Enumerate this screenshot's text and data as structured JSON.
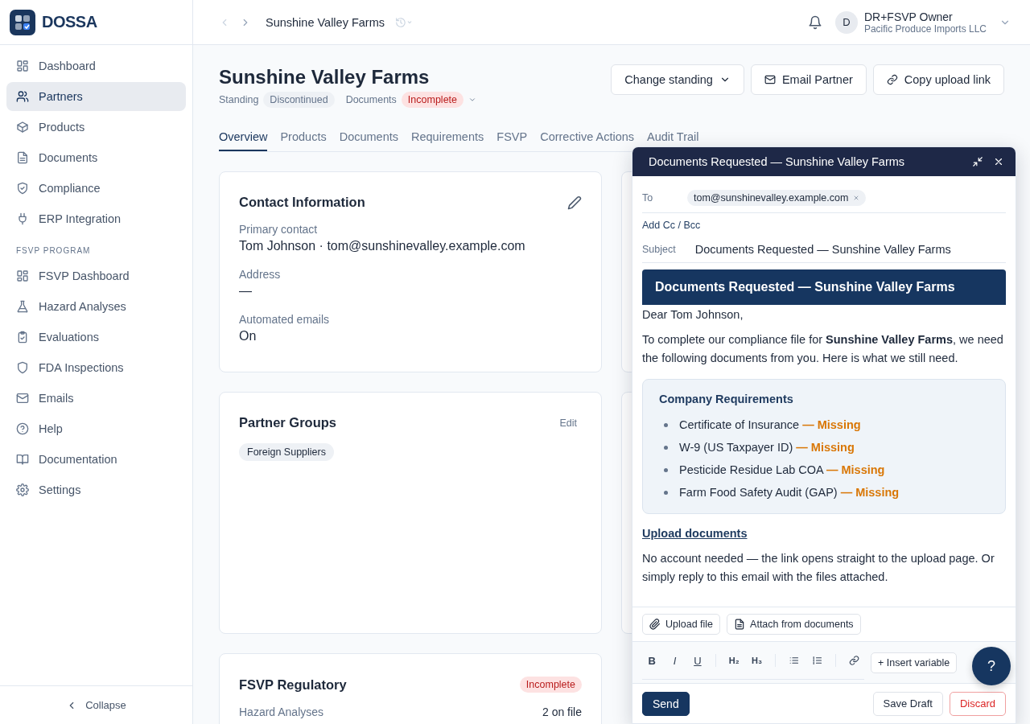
{
  "brand": {
    "name": "DOSSA"
  },
  "sidebar": {
    "groups": [
      {
        "items": [
          {
            "label": "Dashboard",
            "selected": false
          },
          {
            "label": "Partners",
            "selected": true
          },
          {
            "label": "Products",
            "selected": false
          },
          {
            "label": "Documents",
            "selected": false
          },
          {
            "label": "Compliance",
            "selected": false
          },
          {
            "label": "ERP Integration",
            "selected": false
          }
        ]
      },
      {
        "heading": "FSVP PROGRAM",
        "items": [
          {
            "label": "FSVP Dashboard",
            "selected": false
          },
          {
            "label": "Hazard Analyses",
            "selected": false
          },
          {
            "label": "Evaluations",
            "selected": false
          },
          {
            "label": "FDA Inspections",
            "selected": false
          },
          {
            "label": "Emails",
            "selected": false
          },
          {
            "label": "Help",
            "selected": false
          },
          {
            "label": "Documentation",
            "selected": false
          },
          {
            "label": "Settings",
            "selected": false
          }
        ]
      }
    ],
    "collapse": "Collapse"
  },
  "topbar": {
    "breadcrumb": "Sunshine Valley Farms",
    "user": {
      "initial": "D",
      "name": "DR+FSVP Owner",
      "org": "Pacific Produce Imports LLC"
    }
  },
  "header": {
    "title": "Sunshine Valley Farms",
    "meta": [
      {
        "label": "Standing",
        "value": "Discontinued",
        "kind": "neutral",
        "dropdown": false
      },
      {
        "label": "Documents",
        "value": "Incomplete",
        "kind": "danger",
        "dropdown": true
      }
    ],
    "actions": [
      {
        "label": "Change standing",
        "kind": "dropdown"
      },
      {
        "label": "Email Partner",
        "kind": "mail"
      },
      {
        "label": "Copy upload link",
        "kind": "link"
      }
    ]
  },
  "tabs": [
    {
      "label": "Overview",
      "selected": true
    },
    {
      "label": "Products",
      "selected": false
    },
    {
      "label": "Documents",
      "selected": false
    },
    {
      "label": "Requirements",
      "selected": false
    },
    {
      "label": "FSVP",
      "selected": false
    },
    {
      "label": "Corrective Actions",
      "selected": false
    },
    {
      "label": "Audit Trail",
      "selected": false
    }
  ],
  "cards": [
    {
      "kind": "fields",
      "title": "Contact Information",
      "fields": [
        {
          "label": "Primary contact",
          "value": "Tom Johnson · tom@sunshinevalley.example.com"
        },
        {
          "label": "Address",
          "value": "—"
        },
        {
          "label": "Automated emails",
          "value": "On"
        }
      ]
    },
    {
      "kind": "tags",
      "title": "Partner Groups",
      "edit": "Edit",
      "tags": [
        "Foreign Suppliers"
      ]
    },
    {
      "kind": "rows",
      "title": "FSVP Regulatory",
      "badge": "Incomplete",
      "rows": [
        {
          "label": "Hazard Analyses",
          "value": "2 on file"
        }
      ]
    }
  ],
  "compose": {
    "title": "Documents Requested — Sunshine Valley Farms",
    "to_label": "To",
    "recipients": [
      "tom@sunshinevalley.example.com"
    ],
    "cc": "Add Cc / Bcc",
    "subject_label": "Subject",
    "subject": "Documents Requested — Sunshine Valley Farms",
    "email": {
      "banner": "Documents Requested — Sunshine Valley Farms",
      "greeting": "Dear Tom Johnson,",
      "intro": "To complete our compliance file for **Sunshine Valley Farms**, we need the following documents from you. Here is what we still need.",
      "requirements": {
        "title": "Company Requirements",
        "items": [
          {
            "name": "Certificate of Insurance",
            "status": "— Missing",
            "kind": "missing"
          },
          {
            "name": "W-9 (US Taxpayer ID)",
            "status": "— Missing",
            "kind": "missing"
          },
          {
            "name": "Pesticide Residue Lab COA",
            "status": "— Missing",
            "kind": "missing"
          },
          {
            "name": "Farm Food Safety Audit (GAP)",
            "status": "— Missing",
            "kind": "missing"
          }
        ]
      },
      "link": "Upload documents",
      "note": "No account needed — the link opens straight to the upload page. Or simply reply to this email with the files attached."
    },
    "attachments": [
      {
        "label": "Upload file",
        "kind": "clip"
      },
      {
        "label": "Attach from documents",
        "kind": "doc"
      }
    ],
    "format": [
      "B",
      "I",
      "U",
      "H₂",
      "H₃"
    ],
    "insert": "+ Insert variable",
    "footer": [
      {
        "label": "Send",
        "kind": "primary"
      },
      {
        "label": "Save Draft",
        "kind": "secondary"
      },
      {
        "label": "Discard",
        "kind": "danger"
      }
    ]
  },
  "help": "?"
}
